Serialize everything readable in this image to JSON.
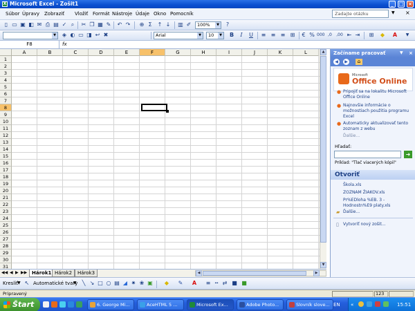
{
  "window": {
    "title": "Microsoft Excel - Zošit1",
    "icon_letter": "X"
  },
  "menu": {
    "items": [
      "Súbor",
      "Úpravy",
      "Zobraziť",
      "Vložiť",
      "Formát",
      "Nástroje",
      "Údaje",
      "Okno",
      "Pomocník"
    ],
    "help_placeholder": "Zadajte otázku"
  },
  "toolbar": {
    "zoom": "100%"
  },
  "format_toolbar": {
    "font_name": "Arial",
    "font_size": "10"
  },
  "formula_bar": {
    "cell_ref": "F8",
    "fx_label": "fx",
    "value": ""
  },
  "grid": {
    "columns": [
      "A",
      "B",
      "C",
      "D",
      "E",
      "F",
      "G",
      "H",
      "I",
      "J",
      "K",
      "L"
    ],
    "active_column": "F",
    "active_row": 8,
    "row_count": 31
  },
  "sheets": {
    "tabs": [
      "Hárok1",
      "Hárok2",
      "Hárok3"
    ],
    "active": "Hárok1"
  },
  "task_pane": {
    "title": "Začíname pracovať",
    "office_small": "Microsoft",
    "office_big": "Office Online",
    "links": [
      "Pripojiť sa na lokalitu Microsoft Office Online",
      "Najnovšie informácie o možnostiach použitia programu Excel",
      "Automaticky aktualizovať tento zoznam z webu"
    ],
    "more": "Ďalšie...",
    "search_label": "Hľadať:",
    "example": "Príklad: \"Tlač viacerých kópií\"",
    "open_header": "Otvoriť",
    "files": [
      "Škola.xls",
      "ZOZNAM ŽIAKOV.xls",
      "Pr%EDloha %EB. 3 - Hodnostn%E9 platy.xls"
    ],
    "open_more": "Ďalšie...",
    "new_workbook": "Vytvoriť nový zošit..."
  },
  "draw_toolbar": {
    "draw_label": "Kresliť",
    "autoshapes_label": "Automatické tvary"
  },
  "status": {
    "text": "Pripravený",
    "num": "123"
  },
  "taskbar": {
    "start": "Štart",
    "tasks": [
      {
        "label": "6. George Mi...",
        "color": "#e8a33a"
      },
      {
        "label": "AceHTML 5 ...",
        "color": "#3aa0e8"
      },
      {
        "label": "Microsoft Ex...",
        "color": "#1f8a3a"
      },
      {
        "label": "Adobe Photo...",
        "color": "#2a4fa0"
      },
      {
        "label": "Slovník slove...",
        "color": "#c04040"
      }
    ],
    "active_task": 2,
    "lang": "EN",
    "clock": "15:51"
  }
}
